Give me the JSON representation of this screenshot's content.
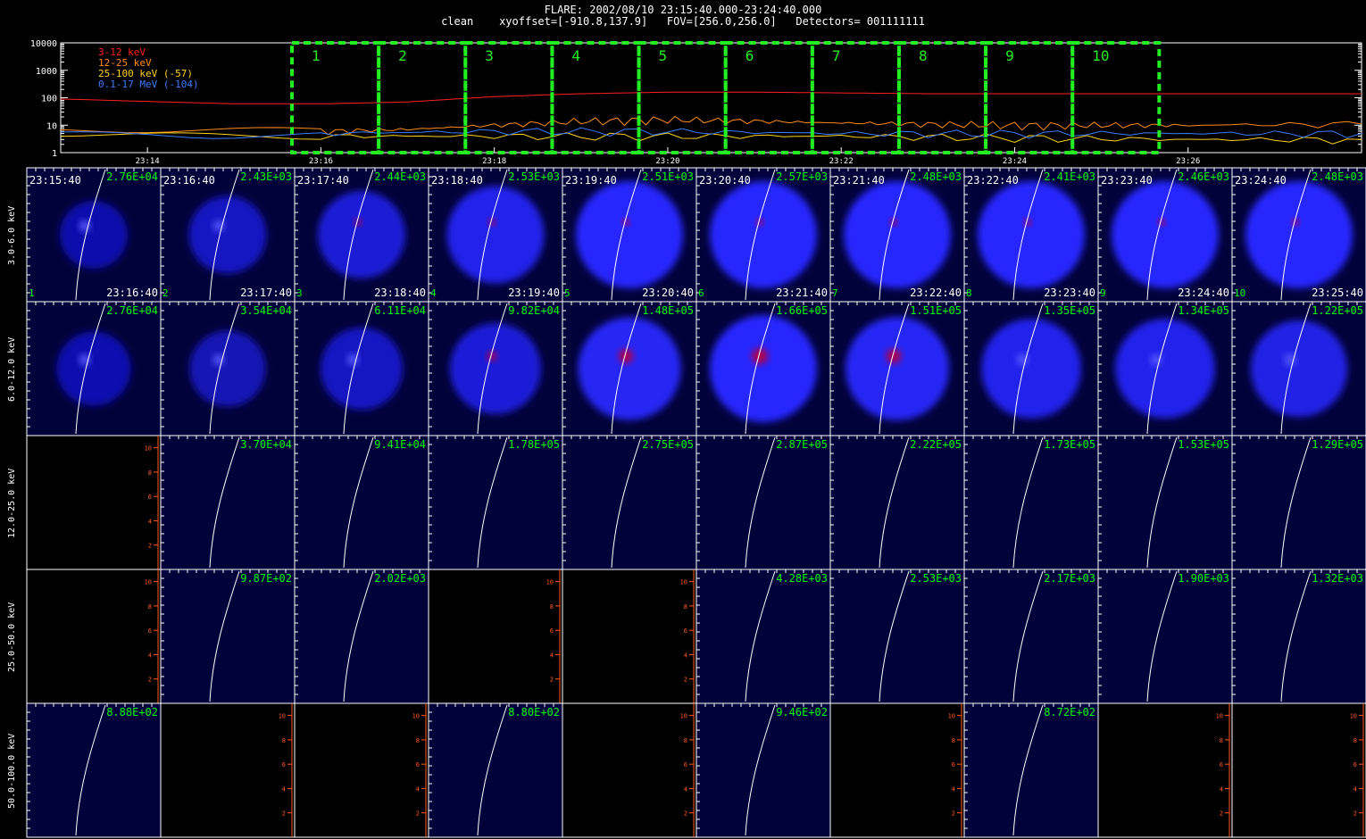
{
  "header": {
    "title": "FLARE: 2002/08/10 23:15:40.000-23:24:40.000",
    "subtitle": "clean    xyoffset=[-910.8,137.9]   FOV=[256.0,256.0]   Detectors= 001111111"
  },
  "chart_data": [
    {
      "type": "line",
      "scale": "log",
      "ylim": [
        1,
        10000
      ],
      "y_ticks": [
        "10000",
        "1000",
        "100",
        "10",
        "1"
      ],
      "x_ticks": [
        "23:14",
        "23:16",
        "23:18",
        "23:20",
        "23:22",
        "23:24",
        "23:26"
      ],
      "x_range": [
        "23:13:00",
        "23:28:00"
      ],
      "series": [
        {
          "name": "3-12 keV",
          "color": "#ff2020",
          "x": [
            "23:13",
            "23:15",
            "23:16",
            "23:17",
            "23:18",
            "23:19",
            "23:20",
            "23:21",
            "23:22",
            "23:23",
            "23:24",
            "23:25",
            "23:26",
            "23:28"
          ],
          "values": [
            90,
            60,
            60,
            70,
            110,
            140,
            160,
            160,
            150,
            140,
            140,
            140,
            140,
            140
          ]
        },
        {
          "name": "12-25 keV",
          "color": "#ff8c1a",
          "x": [
            "23:13",
            "23:16",
            "23:17",
            "23:18",
            "23:19",
            "23:20",
            "23:21",
            "23:22",
            "23:23",
            "23:24",
            "23:25",
            "23:26",
            "23:28"
          ],
          "values": [
            7,
            6,
            7,
            10,
            14,
            16,
            14,
            12,
            11,
            10,
            10,
            10,
            11
          ]
        },
        {
          "name": "25-100 keV (-57)",
          "color": "#ffd21a",
          "x": [
            "23:13",
            "23:16",
            "23:18",
            "23:20",
            "23:22",
            "23:24",
            "23:26",
            "23:28"
          ],
          "values": [
            4,
            4,
            4,
            4,
            4,
            3.5,
            3,
            3
          ]
        },
        {
          "name": "0.1-17 MeV (-104)",
          "color": "#3d7cff",
          "x": [
            "23:13",
            "23:16",
            "23:18",
            "23:20",
            "23:22",
            "23:24",
            "23:26",
            "23:28"
          ],
          "values": [
            5,
            5,
            6,
            6,
            5,
            5,
            5,
            5
          ]
        }
      ],
      "intervals": [
        "1",
        "2",
        "3",
        "4",
        "5",
        "6",
        "7",
        "8",
        "9",
        "10"
      ]
    },
    {
      "type": "heatmap",
      "row_labels": [
        "3.0-6.0 keV",
        "6.0-12.0 keV",
        "12.0-25.0 keV",
        "25.0-50.0 keV",
        "50.0-100.0 keV"
      ],
      "start_times": [
        "23:15:40",
        "23:16:40",
        "23:17:40",
        "23:18:40",
        "23:19:40",
        "23:20:40",
        "23:21:40",
        "23:22:40",
        "23:23:40",
        "23:24:40"
      ],
      "end_times": [
        "23:16:40",
        "23:17:40",
        "23:18:40",
        "23:19:40",
        "23:20:40",
        "23:21:40",
        "23:22:40",
        "23:23:40",
        "23:24:40",
        "23:25:40"
      ],
      "panel_numbers": [
        "1",
        "2",
        "3",
        "4",
        "5",
        "6",
        "7",
        "8",
        "9",
        "10"
      ],
      "max_values": [
        [
          "2.76E+04",
          "2.43E+03",
          "2.44E+03",
          "2.53E+03",
          "2.51E+03",
          "2.57E+03",
          "2.48E+03",
          "2.41E+03",
          "2.46E+03",
          "2.48E+03"
        ],
        [
          "2.76E+04",
          "3.54E+04",
          "6.11E+04",
          "9.82E+04",
          "1.48E+05",
          "1.66E+05",
          "1.51E+05",
          "1.35E+05",
          "1.34E+05",
          "1.22E+05"
        ],
        [
          null,
          "3.70E+04",
          "9.41E+04",
          "1.78E+05",
          "2.75E+05",
          "2.87E+05",
          "2.22E+05",
          "1.73E+05",
          "1.53E+05",
          "1.29E+05"
        ],
        [
          null,
          "9.87E+02",
          "2.02E+03",
          null,
          null,
          "4.28E+03",
          "2.53E+03",
          "2.17E+03",
          "1.90E+03",
          "1.32E+03"
        ],
        [
          "8.88E+02",
          null,
          null,
          "8.80E+02",
          null,
          "9.46E+02",
          null,
          "8.72E+02",
          null,
          null
        ]
      ],
      "empty_axis_ticks": [
        "2",
        "4",
        "6",
        "8",
        "10"
      ],
      "colors": {
        "text": "#00ff00",
        "axis": "#ff5a1e",
        "panel_bg": "#02023a",
        "source_core": "#b0004a"
      }
    }
  ]
}
